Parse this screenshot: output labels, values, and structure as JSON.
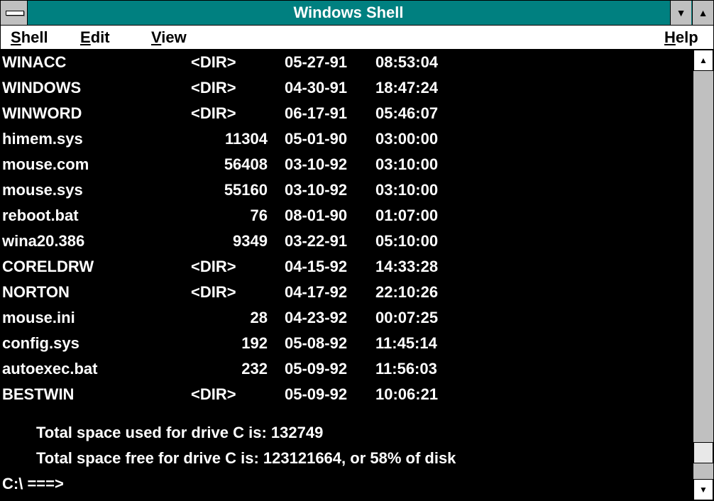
{
  "window": {
    "title": "Windows Shell"
  },
  "menubar": {
    "shell": {
      "mnemonic": "S",
      "rest": "hell"
    },
    "edit": {
      "mnemonic": "E",
      "rest": "dit"
    },
    "view": {
      "mnemonic": "V",
      "rest": "iew"
    },
    "help": {
      "mnemonic": "H",
      "rest": "elp"
    }
  },
  "icons": {
    "system_menu": "system-menu-icon",
    "minimize": "triangle-down",
    "maximize": "triangle-up",
    "scroll_up": "arrow-up",
    "scroll_down": "arrow-down"
  },
  "listing": [
    {
      "name": "WINACC",
      "size": "<DIR>",
      "date": "05-27-91",
      "time": "08:53:04"
    },
    {
      "name": "WINDOWS",
      "size": "<DIR>",
      "date": "04-30-91",
      "time": "18:47:24"
    },
    {
      "name": "WINWORD",
      "size": "<DIR>",
      "date": "06-17-91",
      "time": "05:46:07"
    },
    {
      "name": "himem.sys",
      "size": "11304",
      "date": "05-01-90",
      "time": "03:00:00"
    },
    {
      "name": "mouse.com",
      "size": "56408",
      "date": "03-10-92",
      "time": "03:10:00"
    },
    {
      "name": "mouse.sys",
      "size": "55160",
      "date": "03-10-92",
      "time": "03:10:00"
    },
    {
      "name": "reboot.bat",
      "size": "76",
      "date": "08-01-90",
      "time": "01:07:00"
    },
    {
      "name": "wina20.386",
      "size": "9349",
      "date": "03-22-91",
      "time": "05:10:00"
    },
    {
      "name": "CORELDRW",
      "size": "<DIR>",
      "date": "04-15-92",
      "time": "14:33:28"
    },
    {
      "name": "NORTON",
      "size": "<DIR>",
      "date": "04-17-92",
      "time": "22:10:26"
    },
    {
      "name": "mouse.ini",
      "size": "28",
      "date": "04-23-92",
      "time": "00:07:25"
    },
    {
      "name": "config.sys",
      "size": "192",
      "date": "05-08-92",
      "time": "11:45:14"
    },
    {
      "name": "autoexec.bat",
      "size": "232",
      "date": "05-09-92",
      "time": "11:56:03"
    },
    {
      "name": "BESTWIN",
      "size": "<DIR>",
      "date": "05-09-92",
      "time": "10:06:21"
    }
  ],
  "summary": {
    "used": "Total space used for drive C is: 132749",
    "free": "Total space free for drive C is: 123121664, or 58% of disk"
  },
  "prompt": "C:\\ ===>",
  "scroll": {
    "position_fraction": 0.96
  }
}
